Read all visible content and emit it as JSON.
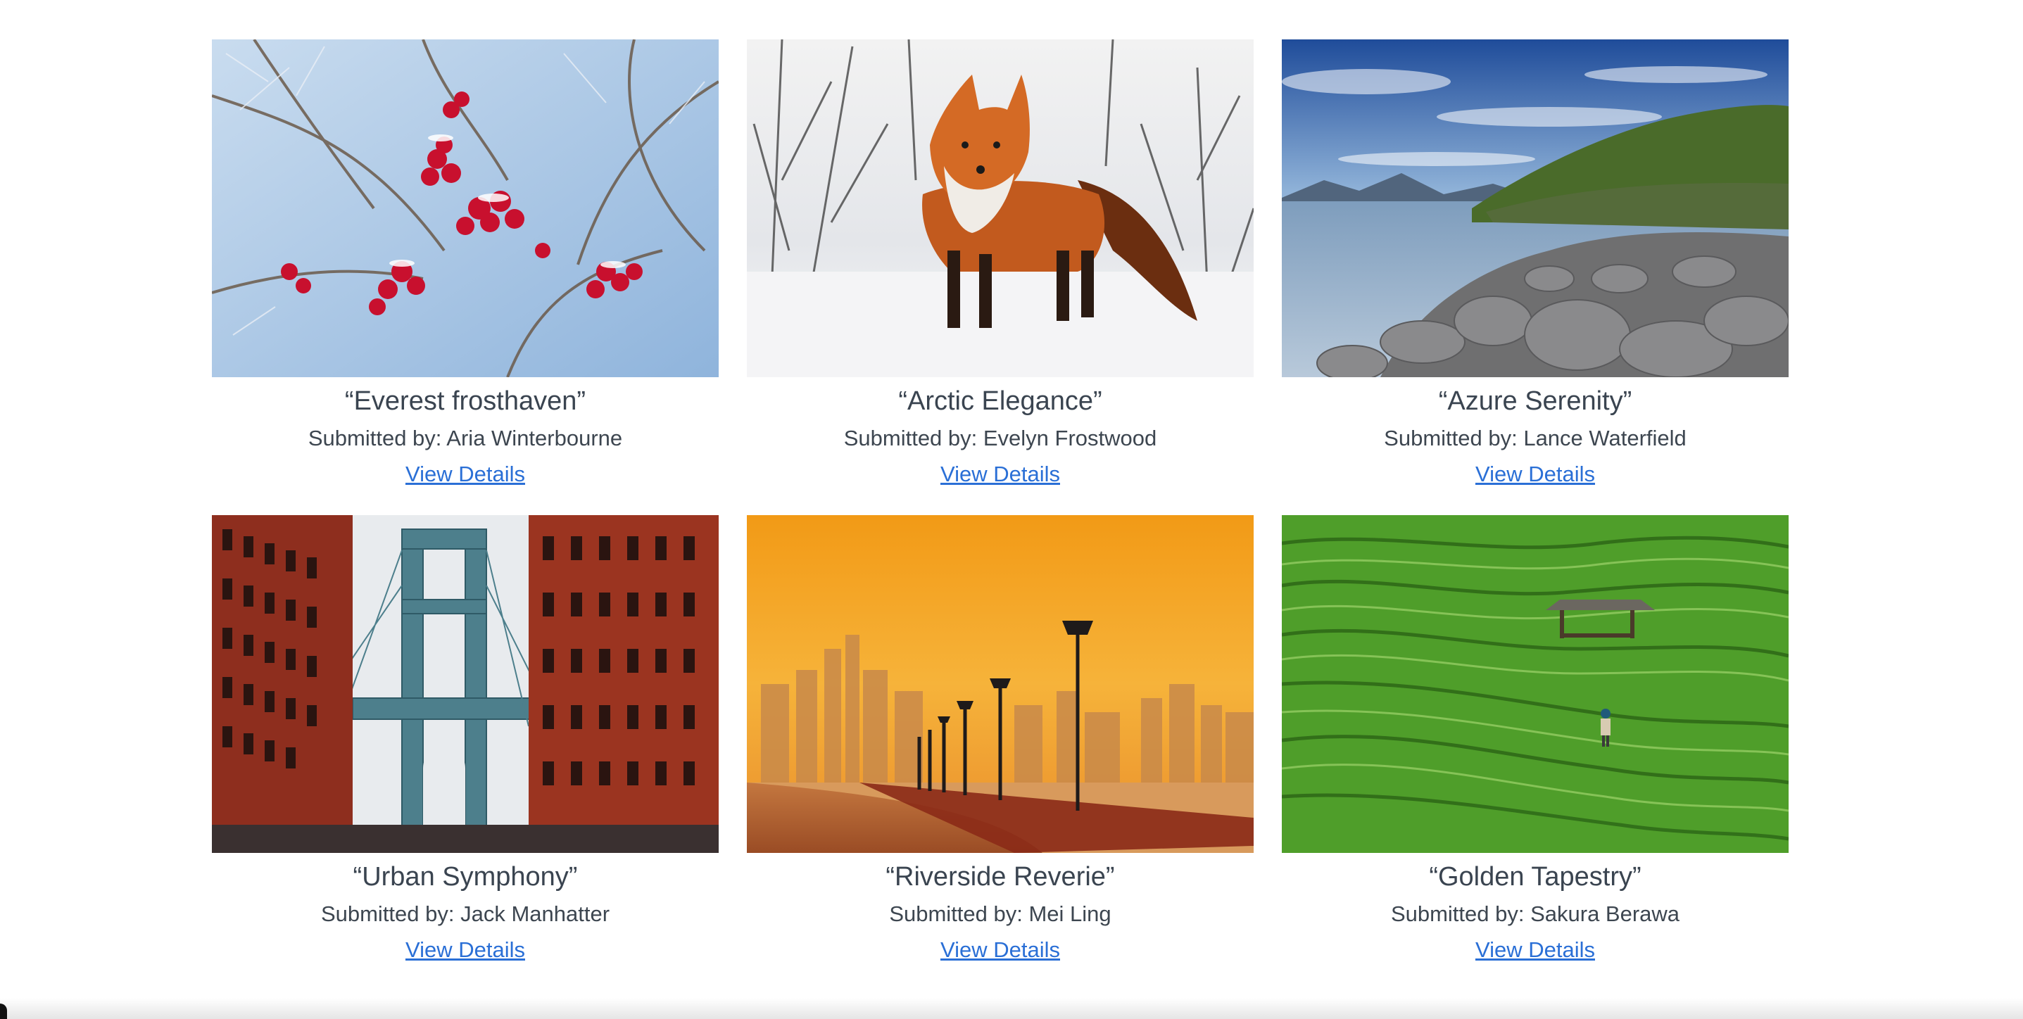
{
  "gallery": {
    "cards": [
      {
        "title": "“Everest frosthaven”",
        "submitter": "Submitted by: Aria Winterbourne",
        "link": "View Details",
        "image": "frosted red berries on branches"
      },
      {
        "title": "“Arctic Elegance”",
        "submitter": "Submitted by: Evelyn Frostwood",
        "link": "View Details",
        "image": "red fox standing in snow"
      },
      {
        "title": "“Azure Serenity”",
        "submitter": "Submitted by: Lance Waterfield",
        "link": "View Details",
        "image": "rocky coastline with blue sky"
      },
      {
        "title": "“Urban Symphony”",
        "submitter": "Submitted by: Jack Manhatter",
        "link": "View Details",
        "image": "bridge between red brick buildings"
      },
      {
        "title": "“Riverside Reverie”",
        "submitter": "Submitted by: Mei Ling",
        "link": "View Details",
        "image": "riverside promenade at golden sunset"
      },
      {
        "title": "“Golden Tapestry”",
        "submitter": "Submitted by: Sakura Berawa",
        "link": "View Details",
        "image": "green rice terraces with hut"
      }
    ]
  },
  "colors": {
    "link": "#2a6fd6",
    "text": "#3a4450"
  }
}
